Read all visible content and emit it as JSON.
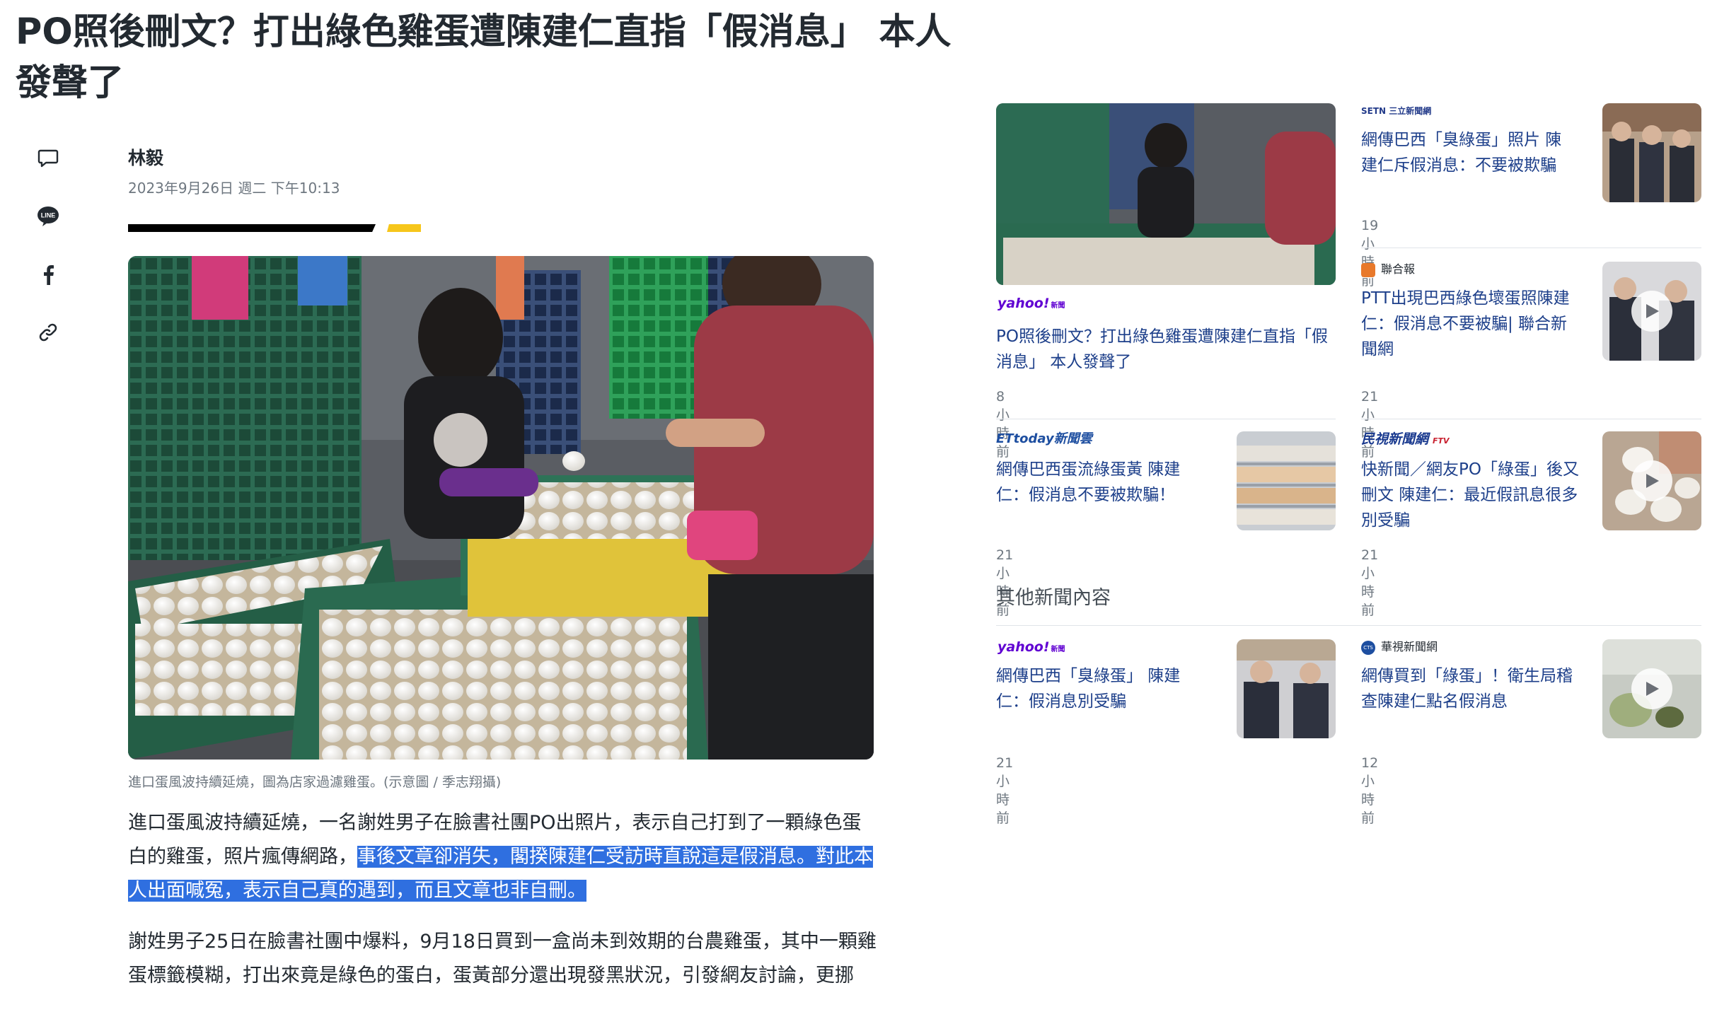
{
  "article": {
    "title": "PO照後刪文？打出綠色雞蛋遭陳建仁直指「假消息」 本人發聲了",
    "author": "林毅",
    "date": "2023年9月26日 週二 下午10:13",
    "image_caption": "進口蛋風波持續延燒，圖為店家過濾雞蛋。(示意圖 / 季志翔攝)",
    "para1_a": "進口蛋風波持續延燒，一名謝姓男子在臉書社團PO出照片，表示自己打到了一顆綠色蛋白的雞蛋，照片瘋傳網路，",
    "para1_b": "事後文章卻消失，閣揆陳建仁受訪時直說這是假消息。對此本人出面喊冤，表示自己真的遇到，而且文章也非自刪。",
    "para2": "謝姓男子25日在臉書社團中爆料，9月18日買到一盒尚未到效期的台農雞蛋，其中一顆雞蛋標籤模糊，打出來竟是綠色的蛋白，蛋黃部分還出現發黑狀況，引發網友討論，更挪"
  },
  "share": {
    "icons": [
      "comment-icon",
      "line-icon",
      "facebook-icon",
      "link-icon"
    ],
    "line_label": "LINE"
  },
  "related": [
    {
      "source": "yahoo!",
      "source_sub": "新聞",
      "title": "PO照後刪文？打出綠色雞蛋遭陳建仁直指「假消息」 本人發聲了",
      "time": "8 小時前"
    },
    {
      "source": "SETN 三立新聞網",
      "title": "網傳巴西「臭綠蛋」照片 陳建仁斥假消息：不要被欺騙",
      "time": "19 小時前"
    },
    {
      "source": "聯合報",
      "title": "PTT出現巴西綠色壞蛋照陳建仁：假消息不要被騙| 聯合新聞網",
      "time": "21 小時前"
    },
    {
      "source": "ETtoday新聞雲",
      "title": "網傳巴西蛋流綠蛋黃 陳建仁：假消息不要被欺騙！",
      "time": "21 小時前"
    },
    {
      "source": "民視新聞網",
      "source_sub": "FTV",
      "title": "快新聞／網友PO「綠蛋」後又刪文 陳建仁：最近假訊息很多別受騙",
      "time": "21 小時前"
    }
  ],
  "other_section_title": "其他新聞內容",
  "other": [
    {
      "source": "yahoo!",
      "source_sub": "新聞",
      "title": "網傳巴西「臭綠蛋」 陳建仁：假消息別受騙",
      "time": "21 小時前"
    },
    {
      "source": "華視新聞網",
      "source_sub": "CTS",
      "title": "網傳買到「綠蛋」！衛生局稽查陳建仁點名假消息",
      "time": "12 小時前"
    }
  ],
  "colors": {
    "highlight": "#2f6fe0",
    "link": "#1d3f8a",
    "yahoo": "#6001d2",
    "divider_yellow": "#f6c61b"
  }
}
